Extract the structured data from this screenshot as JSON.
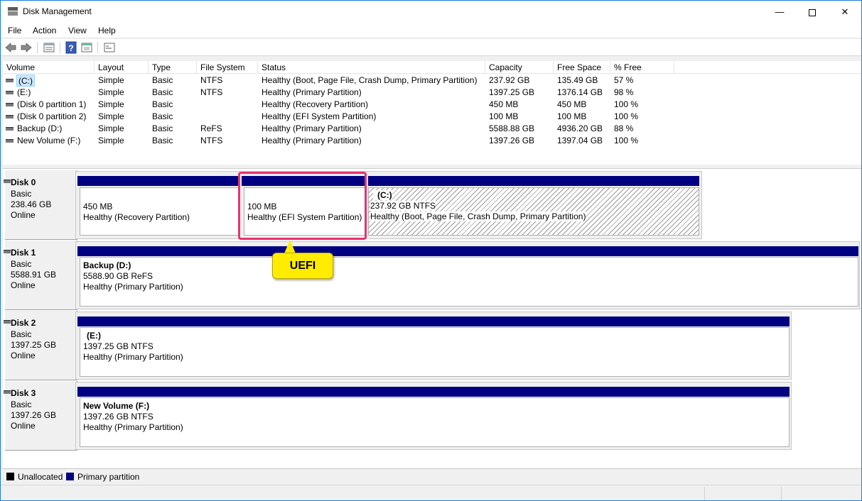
{
  "window": {
    "title": "Disk Management",
    "accent": "#1a7ed8"
  },
  "menu": [
    "File",
    "Action",
    "View",
    "Help"
  ],
  "toolbar_icons": [
    "back-icon",
    "forward-icon",
    "properties-icon",
    "help-icon",
    "refresh-icon",
    "console-icon"
  ],
  "volume_list": {
    "columns": [
      "Volume",
      "Layout",
      "Type",
      "File System",
      "Status",
      "Capacity",
      "Free Space",
      "% Free"
    ],
    "rows": [
      [
        "(C:)",
        "Simple",
        "Basic",
        "NTFS",
        "Healthy (Boot, Page File, Crash Dump, Primary Partition)",
        "237.92 GB",
        "135.49 GB",
        "57 %"
      ],
      [
        "(E:)",
        "Simple",
        "Basic",
        "NTFS",
        "Healthy (Primary Partition)",
        "1397.25 GB",
        "1376.14 GB",
        "98 %"
      ],
      [
        "(Disk 0 partition 1)",
        "Simple",
        "Basic",
        "",
        "Healthy (Recovery Partition)",
        "450 MB",
        "450 MB",
        "100 %"
      ],
      [
        "(Disk 0 partition 2)",
        "Simple",
        "Basic",
        "",
        "Healthy (EFI System Partition)",
        "100 MB",
        "100 MB",
        "100 %"
      ],
      [
        "Backup (D:)",
        "Simple",
        "Basic",
        "ReFS",
        "Healthy (Primary Partition)",
        "5588.88 GB",
        "4936.20 GB",
        "88 %"
      ],
      [
        "New Volume (F:)",
        "Simple",
        "Basic",
        "NTFS",
        "Healthy (Primary Partition)",
        "1397.26 GB",
        "1397.04 GB",
        "100 %"
      ]
    ],
    "selected_row": 0
  },
  "disks": [
    {
      "name": "Disk 0",
      "type": "Basic",
      "size": "238.46 GB",
      "state": "Online",
      "partitions": [
        {
          "title": "",
          "line1": "450 MB",
          "line2": "Healthy (Recovery Partition)"
        },
        {
          "title": "",
          "line1": "100 MB",
          "line2": "Healthy (EFI System Partition)"
        },
        {
          "title": "(C:)",
          "line1": "237.92 GB NTFS",
          "line2": "Healthy (Boot, Page File, Crash Dump, Primary Partition)"
        }
      ]
    },
    {
      "name": "Disk 1",
      "type": "Basic",
      "size": "5588.91 GB",
      "state": "Online",
      "partitions": [
        {
          "title": "Backup  (D:)",
          "line1": "5588.90 GB ReFS",
          "line2": "Healthy (Primary Partition)"
        }
      ]
    },
    {
      "name": "Disk 2",
      "type": "Basic",
      "size": "1397.25 GB",
      "state": "Online",
      "partitions": [
        {
          "title": "(E:)",
          "line1": "1397.25 GB NTFS",
          "line2": "Healthy (Primary Partition)"
        }
      ]
    },
    {
      "name": "Disk 3",
      "type": "Basic",
      "size": "1397.26 GB",
      "state": "Online",
      "partitions": [
        {
          "title": "New Volume  (F:)",
          "line1": "1397.26 GB NTFS",
          "line2": "Healthy (Primary Partition)"
        }
      ]
    }
  ],
  "callout": {
    "text": "UEFI",
    "color": "#ffec00",
    "highlight_color": "#e8336e"
  },
  "legend": [
    {
      "label": "Unallocated",
      "color": "#000000"
    },
    {
      "label": "Primary partition",
      "color": "#000080"
    }
  ]
}
